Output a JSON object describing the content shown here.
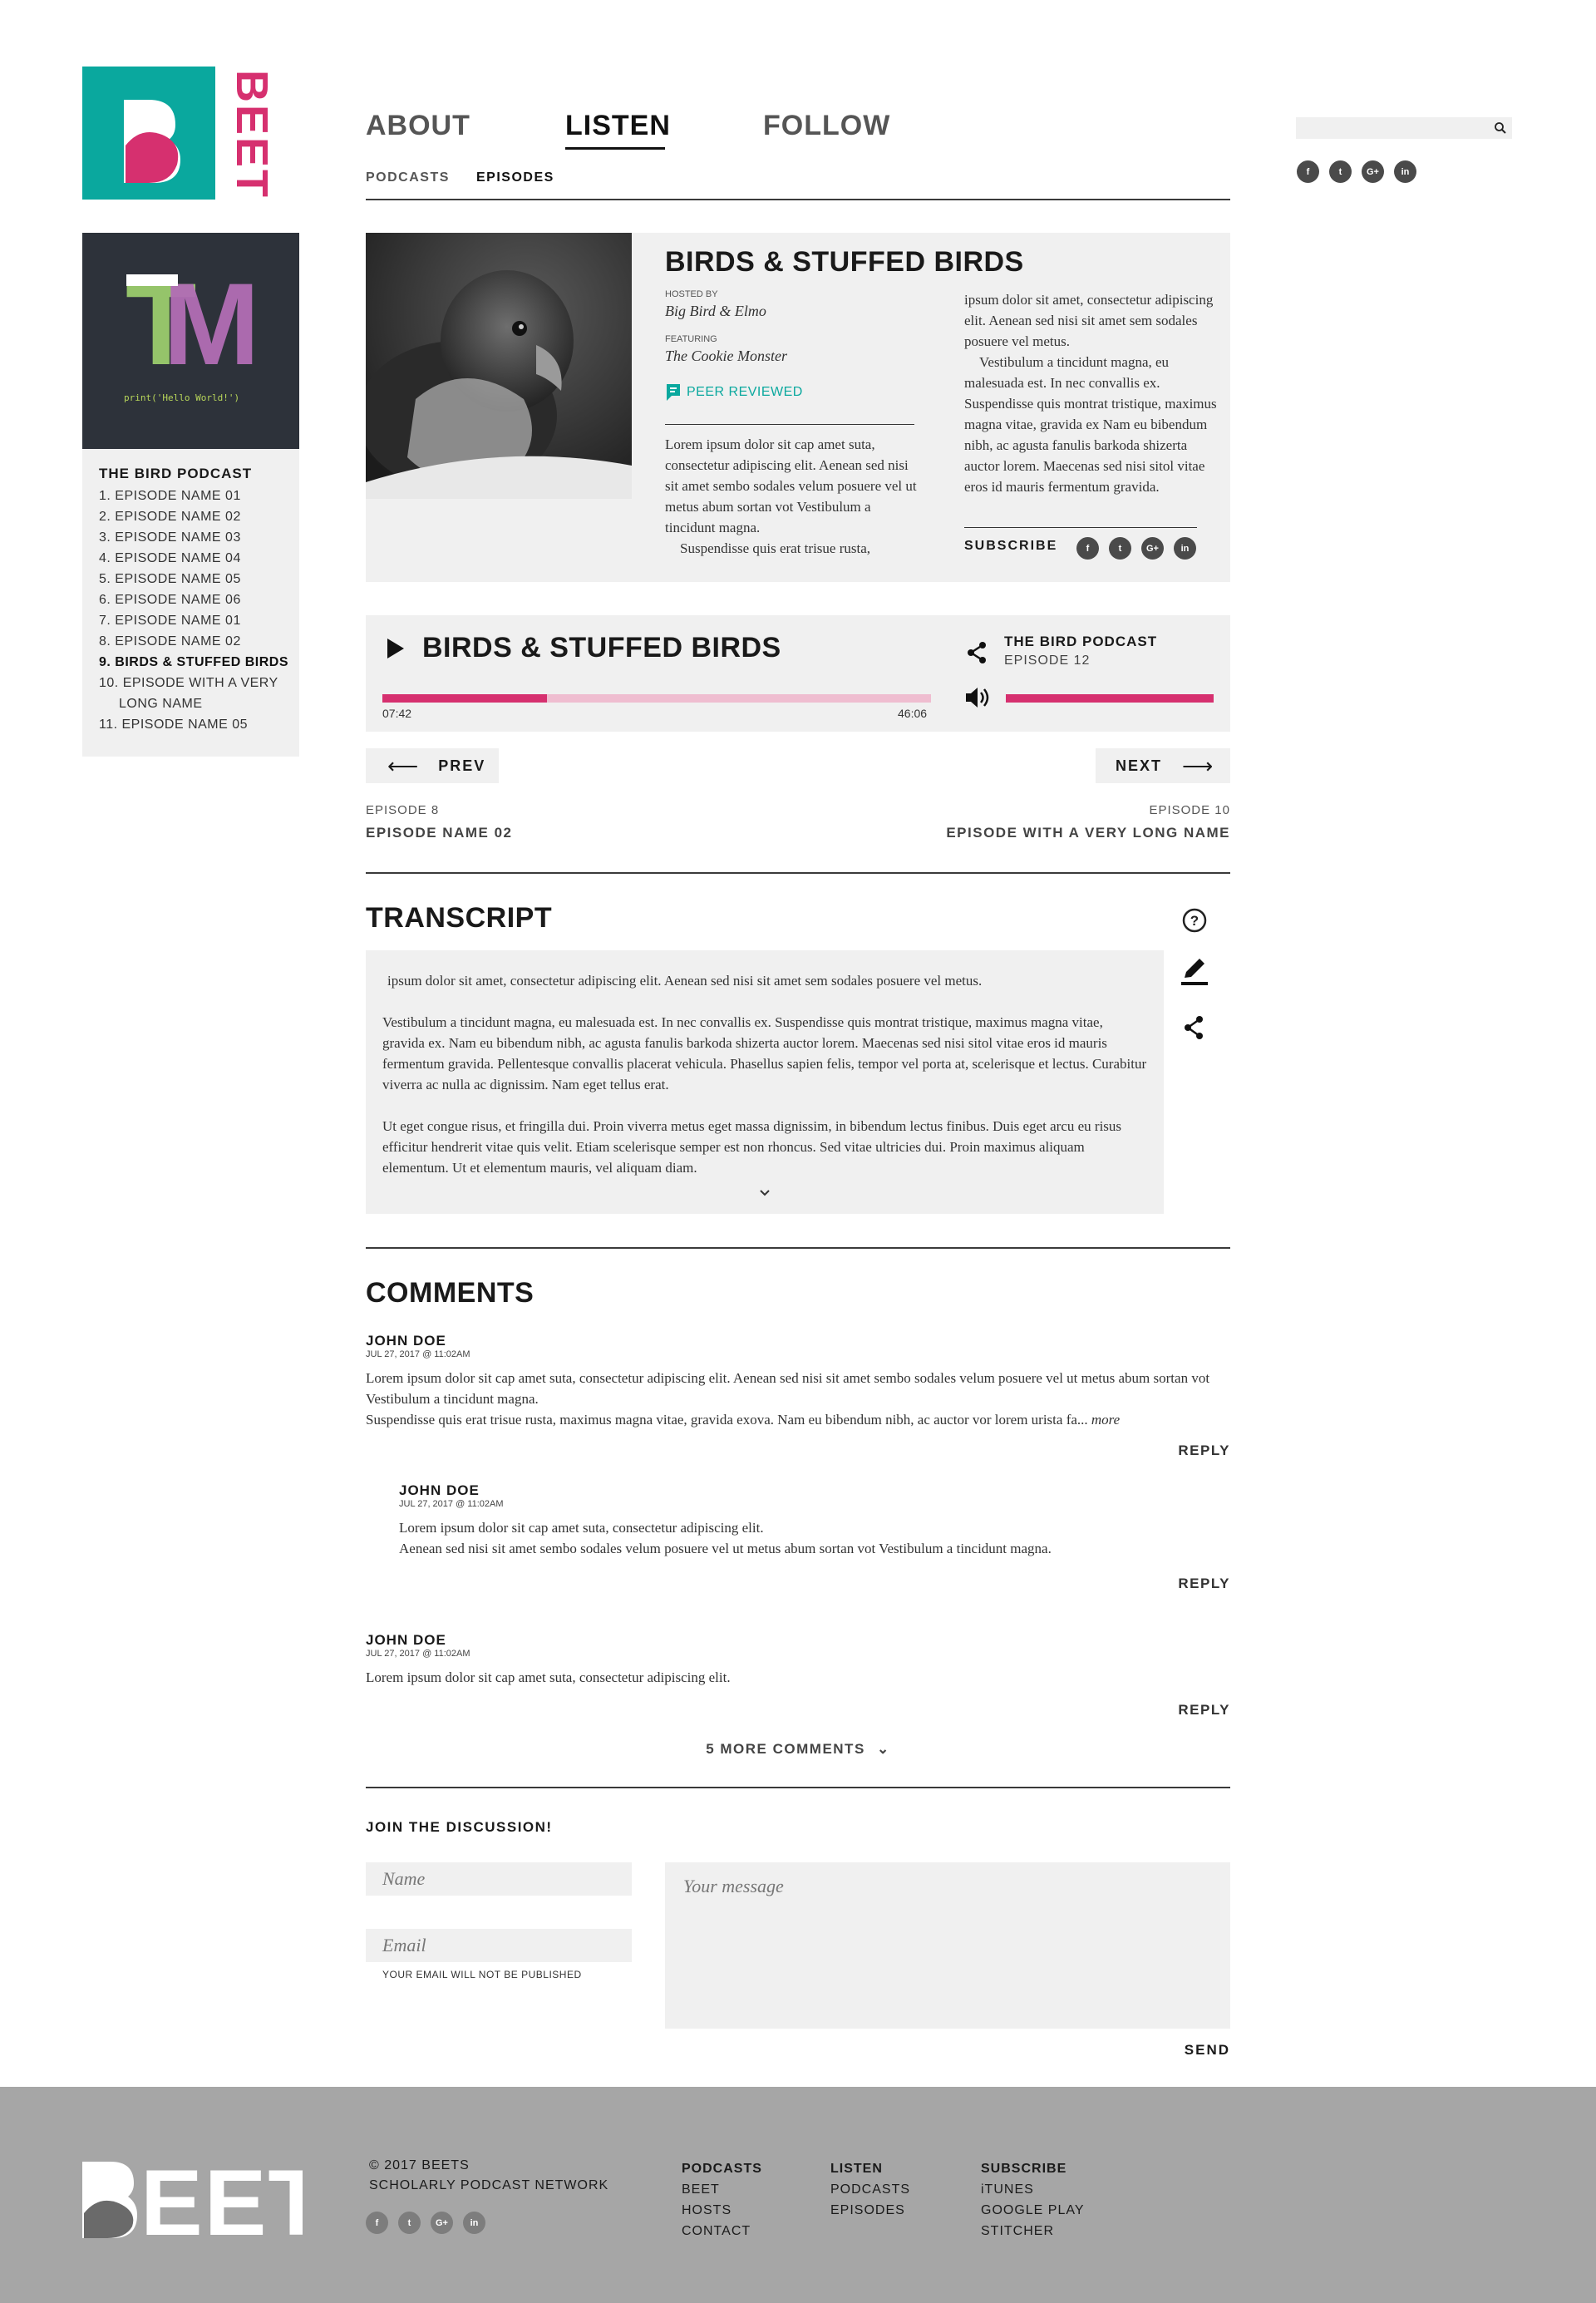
{
  "brand": {
    "name": "BEET",
    "teal": "#0aa89e",
    "pink": "#d6306f"
  },
  "nav": {
    "main": [
      {
        "label": "ABOUT",
        "active": false
      },
      {
        "label": "LISTEN",
        "active": true
      },
      {
        "label": "FOLLOW",
        "active": false
      }
    ],
    "sub": [
      {
        "label": "PODCASTS",
        "active": false
      },
      {
        "label": "EPISODES",
        "active": true
      }
    ]
  },
  "search": {
    "placeholder": "",
    "icon": "search-icon"
  },
  "social": [
    "f",
    "t",
    "G+",
    "in"
  ],
  "sidebar": {
    "cover_letters": [
      "T",
      "M"
    ],
    "cover_code": "print('Hello World!')",
    "podcast_title": "THE BIRD PODCAST",
    "episodes": [
      "1. EPISODE NAME 01",
      "2. EPISODE NAME 02",
      "3. EPISODE NAME 03",
      "4. EPISODE NAME 04",
      "5. EPISODE NAME 05",
      "6. EPISODE NAME 06",
      "7. EPISODE NAME 01",
      "8. EPISODE NAME 02",
      "9. BIRDS & STUFFED BIRDS",
      "10. EPISODE WITH A VERY",
      "LONG NAME",
      "11. EPISODE NAME 05"
    ],
    "active_index": 8
  },
  "episode": {
    "title": "BIRDS & STUFFED BIRDS",
    "hosted_by_label": "HOSTED BY",
    "hosted_by": "Big Bird & Elmo",
    "featuring_label": "FEATURING",
    "featuring": "The Cookie Monster",
    "peer_reviewed": "PEER REVIEWED",
    "desc_left": "Lorem ipsum dolor sit cap amet suta, consectetur adipiscing elit. Aenean sed nisi sit amet sembo sodales velum posuere vel ut metus abum sortan vot Vestibulum a tincidunt magna.",
    "desc_left_2": "Suspendisse quis erat trisue rusta,",
    "desc_right": "ipsum dolor sit amet, consectetur adipiscing elit. Aenean sed nisi sit amet sem sodales posuere vel metus.",
    "desc_right_2": "Vestibulum a tincidunt magna, eu malesuada est. In nec convallis ex. Suspendisse quis montrat tristique, maximus magna vitae, gravida ex Nam eu bibendum nibh, ac agusta fanulis barkoda shizerta auctor lorem. Maecenas sed nisi sitol vitae eros id mauris fermentum gravida.",
    "subscribe_label": "SUBSCRIBE"
  },
  "player": {
    "title": "BIRDS & STUFFED BIRDS",
    "podcast": "THE BIRD PODCAST",
    "episode_label": "EPISODE 12",
    "current_time": "07:42",
    "total_time": "46:06",
    "progress": 0.3,
    "volume": 1.0
  },
  "prevnext": {
    "prev_label": "PREV",
    "next_label": "NEXT",
    "prev_episode": "EPISODE 8",
    "prev_name": "EPISODE NAME 02",
    "next_episode": "EPISODE 10",
    "next_name": "EPISODE WITH A VERY LONG NAME"
  },
  "transcript": {
    "heading": "TRANSCRIPT",
    "p1": "ipsum dolor sit amet, consectetur adipiscing elit. Aenean sed nisi sit amet sem sodales posuere vel metus.",
    "p2": "Vestibulum a tincidunt magna, eu malesuada est. In nec convallis ex. Suspendisse quis montrat tristique, maximus magna vitae, gravida ex. Nam eu bibendum nibh, ac agusta fanulis barkoda shizerta auctor lorem. Maecenas sed nisi sitol vitae eros id mauris fermentum gravida. Pellentesque convallis placerat vehicula. Phasellus sapien felis, tempor vel porta at, scelerisque et lectus. Curabitur viverra ac nulla ac dignissim. Nam eget tellus erat.",
    "p3": "Ut eget congue risus, et fringilla dui. Proin viverra metus eget massa dignissim, in bibendum lectus finibus. Duis eget arcu eu risus efficitur hendrerit vitae quis velit. Etiam scelerisque semper est non rhoncus. Sed vitae ultricies dui. Proin maximus aliquam elementum. Ut et elementum mauris, vel aliquam diam."
  },
  "comments": {
    "heading": "COMMENTS",
    "reply_label": "REPLY",
    "more_label": "more",
    "items": [
      {
        "author": "JOHN DOE",
        "date": "JUL 27, 2017 @ 11:02AM",
        "line1": "Lorem ipsum dolor sit cap amet suta, consectetur adipiscing elit. Aenean sed nisi sit amet sembo sodales velum posuere vel ut metus abum sortan vot Vestibulum a tincidunt magna.",
        "line2": "Suspendisse quis erat trisue rusta, maximus magna vitae, gravida exova. Nam eu bibendum nibh, ac auctor vor lorem urista fa..."
      },
      {
        "author": "JOHN DOE",
        "date": "JUL 27, 2017 @ 11:02AM",
        "line1": "Lorem ipsum dolor sit cap amet suta, consectetur adipiscing elit.",
        "line2": "Aenean sed nisi sit amet sembo sodales velum posuere vel ut metus abum sortan vot Vestibulum a tincidunt magna."
      },
      {
        "author": "JOHN DOE",
        "date": "JUL 27, 2017 @ 11:02AM",
        "line1": "Lorem ipsum dolor sit cap amet suta, consectetur adipiscing elit."
      }
    ],
    "more_comments": "5 MORE COMMENTS"
  },
  "discussion": {
    "heading": "JOIN THE DISCUSSION!",
    "name_placeholder": "Name",
    "email_placeholder": "Email",
    "email_note": "YOUR EMAIL WILL NOT BE PUBLISHED",
    "message_placeholder": "Your message",
    "send_label": "SEND"
  },
  "footer": {
    "copyright": "© 2017  BEETS",
    "network": "SCHOLARLY PODCAST NETWORK",
    "columns": [
      {
        "head": "PODCASTS",
        "items": [
          "BEET",
          "HOSTS",
          "CONTACT"
        ]
      },
      {
        "head": "LISTEN",
        "items": [
          "PODCASTS",
          "EPISODES"
        ]
      },
      {
        "head": "SUBSCRIBE",
        "items": [
          "iTUNES",
          "GOOGLE PLAY",
          "STITCHER"
        ]
      }
    ]
  }
}
